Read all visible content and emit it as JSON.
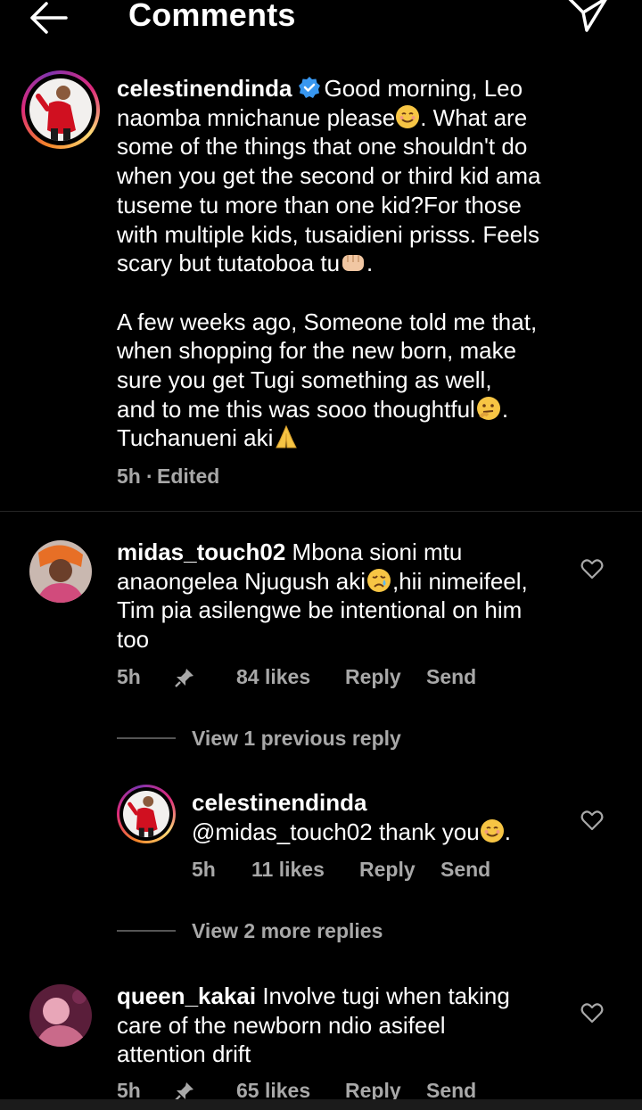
{
  "header": {
    "title": "Comments",
    "back_icon": "arrow-left-icon",
    "send_icon": "paper-plane-icon"
  },
  "caption": {
    "username": "celestinendinda",
    "verified": true,
    "paragraph1_first": "Good morning, Leo",
    "paragraph1_lines": [
      "naomba mnichanue please",
      ". What are",
      "some of the things that one shouldn't do",
      "when you get the second or third kid ama",
      "tuseme tu more than one kid?For those",
      "with multiple kids, tusaidieni prisss. Feels",
      "scary but tutatoboa tu",
      "."
    ],
    "paragraph2_lines": [
      "A few weeks ago, Someone told me that,",
      "when shopping for the new born, make",
      "sure you get Tugi something as well,",
      "and to me this was sooo thoughtful",
      ".",
      "Tuchanueni aki"
    ],
    "time": "5h",
    "edited": "Edited",
    "sep": "·"
  },
  "comments": [
    {
      "username": "midas_touch02",
      "first_text": "Mbona sioni mtu",
      "lines": [
        "anaongelea Njugush aki",
        ",hii nimeifeel,",
        "Tim pia asilengwe be intentional on him",
        "too"
      ],
      "time": "5h",
      "likes": "84 likes",
      "reply": "Reply",
      "send": "Send",
      "view_replies": "View 1 previous reply"
    },
    {
      "username": "celestinendinda",
      "text": "@midas_touch02 thank you",
      "text_end": ".",
      "time": "5h",
      "likes": "11 likes",
      "reply": "Reply",
      "send": "Send",
      "view_more": "View 2 more replies"
    },
    {
      "username": "queen_kakai",
      "first_text": "Involve tugi when taking",
      "lines": [
        "care of the newborn ndio asifeel",
        "attention drift"
      ],
      "time": "5h",
      "likes": "65 likes",
      "reply": "Reply",
      "send": "Send"
    }
  ],
  "colors": {
    "background": "#000000",
    "muted": "#a8a8a8",
    "verified": "#3897f0"
  }
}
